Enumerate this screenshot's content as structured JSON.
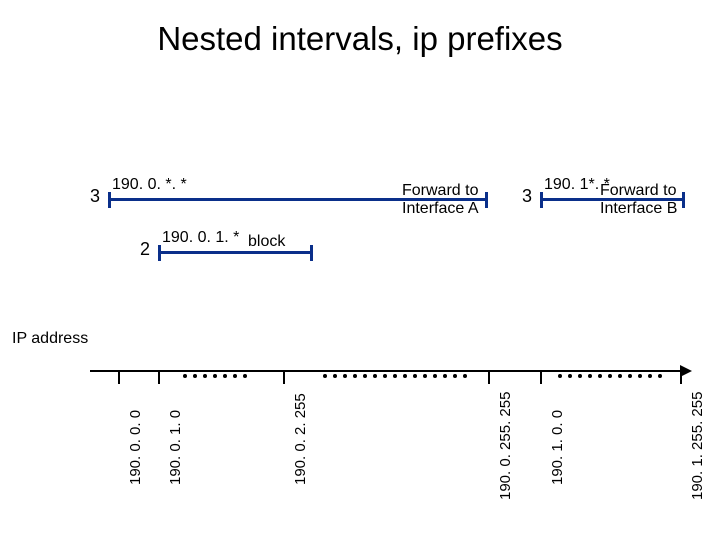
{
  "title": "Nested intervals, ip prefixes",
  "intervals": {
    "a": {
      "len": "3",
      "label": "190. 0. *. *",
      "forward": "Forward to\nInterface A"
    },
    "b": {
      "len": "2",
      "label": "190. 0. 1. *",
      "action": "block"
    },
    "c": {
      "len": "3",
      "label": "190. 1*. *",
      "forward": "Forward to\nInterface B"
    }
  },
  "axis_label": "IP address",
  "ticks": [
    "190. 0. 0. 0",
    "190. 0. 1. 0",
    "190. 0. 2. 255",
    "190. 0. 255. 255",
    "190. 1. 0. 0",
    "190. 1. 255. 255"
  ]
}
